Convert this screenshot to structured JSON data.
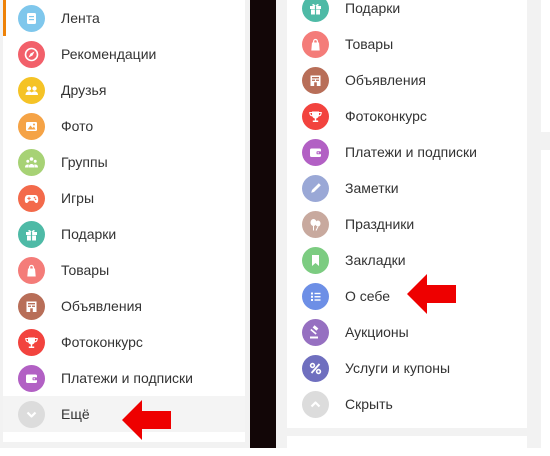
{
  "left_menu": {
    "items": [
      {
        "label": "Лента",
        "icon": "feed-icon",
        "color": "#7fc7ec"
      },
      {
        "label": "Рекомендации",
        "icon": "compass-icon",
        "color": "#f2606a"
      },
      {
        "label": "Друзья",
        "icon": "friends-icon",
        "color": "#f5c326"
      },
      {
        "label": "Фото",
        "icon": "photo-icon",
        "color": "#f5a346"
      },
      {
        "label": "Группы",
        "icon": "groups-icon",
        "color": "#a7d275"
      },
      {
        "label": "Игры",
        "icon": "gamepad-icon",
        "color": "#f36a4b"
      },
      {
        "label": "Подарки",
        "icon": "gift-icon",
        "color": "#4ebaa6"
      },
      {
        "label": "Товары",
        "icon": "shopping-bag-icon",
        "color": "#f47c79"
      },
      {
        "label": "Объявления",
        "icon": "store-icon",
        "color": "#b86e58"
      },
      {
        "label": "Фотоконкурс",
        "icon": "trophy-icon",
        "color": "#f2433e"
      },
      {
        "label": "Платежи и подписки",
        "icon": "wallet-icon",
        "color": "#b260c4"
      },
      {
        "label": "Ещё",
        "icon": "chevron-down-icon",
        "color": "#dcdcdc"
      }
    ]
  },
  "right_menu": {
    "items": [
      {
        "label": "Подарки",
        "icon": "gift-icon",
        "color": "#4ebaa6"
      },
      {
        "label": "Товары",
        "icon": "shopping-bag-icon",
        "color": "#f47c79"
      },
      {
        "label": "Объявления",
        "icon": "store-icon",
        "color": "#b86e58"
      },
      {
        "label": "Фотоконкурс",
        "icon": "trophy-icon",
        "color": "#f2433e"
      },
      {
        "label": "Платежи и подписки",
        "icon": "wallet-icon",
        "color": "#b260c4"
      },
      {
        "label": "Заметки",
        "icon": "pencil-icon",
        "color": "#9aa8d6"
      },
      {
        "label": "Праздники",
        "icon": "balloons-icon",
        "color": "#c8a99e"
      },
      {
        "label": "Закладки",
        "icon": "bookmark-icon",
        "color": "#7ccc81"
      },
      {
        "label": "О себе",
        "icon": "list-icon",
        "color": "#6d8fe6"
      },
      {
        "label": "Аукционы",
        "icon": "gavel-icon",
        "color": "#9670c1"
      },
      {
        "label": "Услуги и купоны",
        "icon": "percent-icon",
        "color": "#6f6fbf"
      },
      {
        "label": "Скрыть",
        "icon": "chevron-up-icon",
        "color": "#dcdcdc"
      }
    ]
  },
  "colors": {
    "accent": "#ee8208",
    "arrow": "#ee0000",
    "divider": "#120607"
  }
}
